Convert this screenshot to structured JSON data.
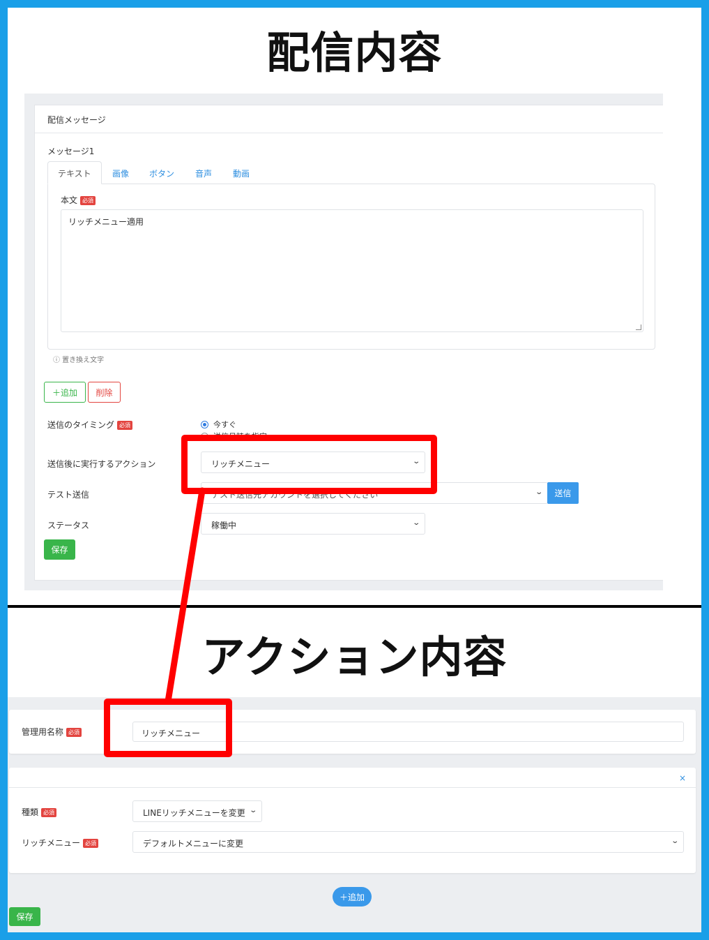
{
  "headings": {
    "top": "配信内容",
    "bottom": "アクション内容"
  },
  "delivery": {
    "card_title": "配信メッセージ",
    "message_label": "メッセージ1",
    "tabs": [
      "テキスト",
      "画像",
      "ボタン",
      "音声",
      "動画"
    ],
    "active_tab": "テキスト",
    "body_label": "本文",
    "required_badge": "必須",
    "body_value": "リッチメニュー適用",
    "hint": "ⓘ 置き換え文字",
    "add_button": "＋追加",
    "delete_button": "削除",
    "timing_label": "送信のタイミング",
    "timing_options": [
      "今すぐ",
      "送信日時を指定"
    ],
    "timing_selected": "今すぐ",
    "after_action_label": "送信後に実行するアクション",
    "after_action_value": "リッチメニュー",
    "test_send_label": "テスト送信",
    "test_send_placeholder": "テスト送信先アカウントを選択してください",
    "send_button": "送信",
    "status_label": "ステータス",
    "status_value": "稼働中",
    "save_button": "保存"
  },
  "action": {
    "name_label": "管理用名称",
    "required_badge": "必須",
    "name_value": "リッチメニュー",
    "close_icon": "×",
    "type_label": "種類",
    "type_value": "LINEリッチメニューを変更",
    "richmenu_label": "リッチメニュー",
    "richmenu_value": "デフォルトメニューに変更",
    "add_button": "＋追加",
    "save_button": "保存"
  },
  "colors": {
    "frame": "#1a9fe8",
    "annotation": "#ff0000",
    "primary": "#3a99ea",
    "success": "#39b54a",
    "danger": "#e3443f"
  }
}
